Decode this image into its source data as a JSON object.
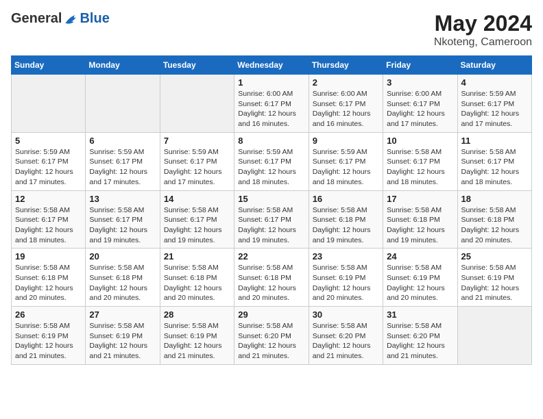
{
  "logo": {
    "general": "General",
    "blue": "Blue"
  },
  "title": {
    "month_year": "May 2024",
    "location": "Nkoteng, Cameroon"
  },
  "headers": [
    "Sunday",
    "Monday",
    "Tuesday",
    "Wednesday",
    "Thursday",
    "Friday",
    "Saturday"
  ],
  "weeks": [
    [
      {
        "day": "",
        "info": ""
      },
      {
        "day": "",
        "info": ""
      },
      {
        "day": "",
        "info": ""
      },
      {
        "day": "1",
        "info": "Sunrise: 6:00 AM\nSunset: 6:17 PM\nDaylight: 12 hours\nand 16 minutes."
      },
      {
        "day": "2",
        "info": "Sunrise: 6:00 AM\nSunset: 6:17 PM\nDaylight: 12 hours\nand 16 minutes."
      },
      {
        "day": "3",
        "info": "Sunrise: 6:00 AM\nSunset: 6:17 PM\nDaylight: 12 hours\nand 17 minutes."
      },
      {
        "day": "4",
        "info": "Sunrise: 5:59 AM\nSunset: 6:17 PM\nDaylight: 12 hours\nand 17 minutes."
      }
    ],
    [
      {
        "day": "5",
        "info": "Sunrise: 5:59 AM\nSunset: 6:17 PM\nDaylight: 12 hours\nand 17 minutes."
      },
      {
        "day": "6",
        "info": "Sunrise: 5:59 AM\nSunset: 6:17 PM\nDaylight: 12 hours\nand 17 minutes."
      },
      {
        "day": "7",
        "info": "Sunrise: 5:59 AM\nSunset: 6:17 PM\nDaylight: 12 hours\nand 17 minutes."
      },
      {
        "day": "8",
        "info": "Sunrise: 5:59 AM\nSunset: 6:17 PM\nDaylight: 12 hours\nand 18 minutes."
      },
      {
        "day": "9",
        "info": "Sunrise: 5:59 AM\nSunset: 6:17 PM\nDaylight: 12 hours\nand 18 minutes."
      },
      {
        "day": "10",
        "info": "Sunrise: 5:58 AM\nSunset: 6:17 PM\nDaylight: 12 hours\nand 18 minutes."
      },
      {
        "day": "11",
        "info": "Sunrise: 5:58 AM\nSunset: 6:17 PM\nDaylight: 12 hours\nand 18 minutes."
      }
    ],
    [
      {
        "day": "12",
        "info": "Sunrise: 5:58 AM\nSunset: 6:17 PM\nDaylight: 12 hours\nand 18 minutes."
      },
      {
        "day": "13",
        "info": "Sunrise: 5:58 AM\nSunset: 6:17 PM\nDaylight: 12 hours\nand 19 minutes."
      },
      {
        "day": "14",
        "info": "Sunrise: 5:58 AM\nSunset: 6:17 PM\nDaylight: 12 hours\nand 19 minutes."
      },
      {
        "day": "15",
        "info": "Sunrise: 5:58 AM\nSunset: 6:17 PM\nDaylight: 12 hours\nand 19 minutes."
      },
      {
        "day": "16",
        "info": "Sunrise: 5:58 AM\nSunset: 6:18 PM\nDaylight: 12 hours\nand 19 minutes."
      },
      {
        "day": "17",
        "info": "Sunrise: 5:58 AM\nSunset: 6:18 PM\nDaylight: 12 hours\nand 19 minutes."
      },
      {
        "day": "18",
        "info": "Sunrise: 5:58 AM\nSunset: 6:18 PM\nDaylight: 12 hours\nand 20 minutes."
      }
    ],
    [
      {
        "day": "19",
        "info": "Sunrise: 5:58 AM\nSunset: 6:18 PM\nDaylight: 12 hours\nand 20 minutes."
      },
      {
        "day": "20",
        "info": "Sunrise: 5:58 AM\nSunset: 6:18 PM\nDaylight: 12 hours\nand 20 minutes."
      },
      {
        "day": "21",
        "info": "Sunrise: 5:58 AM\nSunset: 6:18 PM\nDaylight: 12 hours\nand 20 minutes."
      },
      {
        "day": "22",
        "info": "Sunrise: 5:58 AM\nSunset: 6:18 PM\nDaylight: 12 hours\nand 20 minutes."
      },
      {
        "day": "23",
        "info": "Sunrise: 5:58 AM\nSunset: 6:19 PM\nDaylight: 12 hours\nand 20 minutes."
      },
      {
        "day": "24",
        "info": "Sunrise: 5:58 AM\nSunset: 6:19 PM\nDaylight: 12 hours\nand 20 minutes."
      },
      {
        "day": "25",
        "info": "Sunrise: 5:58 AM\nSunset: 6:19 PM\nDaylight: 12 hours\nand 21 minutes."
      }
    ],
    [
      {
        "day": "26",
        "info": "Sunrise: 5:58 AM\nSunset: 6:19 PM\nDaylight: 12 hours\nand 21 minutes."
      },
      {
        "day": "27",
        "info": "Sunrise: 5:58 AM\nSunset: 6:19 PM\nDaylight: 12 hours\nand 21 minutes."
      },
      {
        "day": "28",
        "info": "Sunrise: 5:58 AM\nSunset: 6:19 PM\nDaylight: 12 hours\nand 21 minutes."
      },
      {
        "day": "29",
        "info": "Sunrise: 5:58 AM\nSunset: 6:20 PM\nDaylight: 12 hours\nand 21 minutes."
      },
      {
        "day": "30",
        "info": "Sunrise: 5:58 AM\nSunset: 6:20 PM\nDaylight: 12 hours\nand 21 minutes."
      },
      {
        "day": "31",
        "info": "Sunrise: 5:58 AM\nSunset: 6:20 PM\nDaylight: 12 hours\nand 21 minutes."
      },
      {
        "day": "",
        "info": ""
      }
    ]
  ]
}
